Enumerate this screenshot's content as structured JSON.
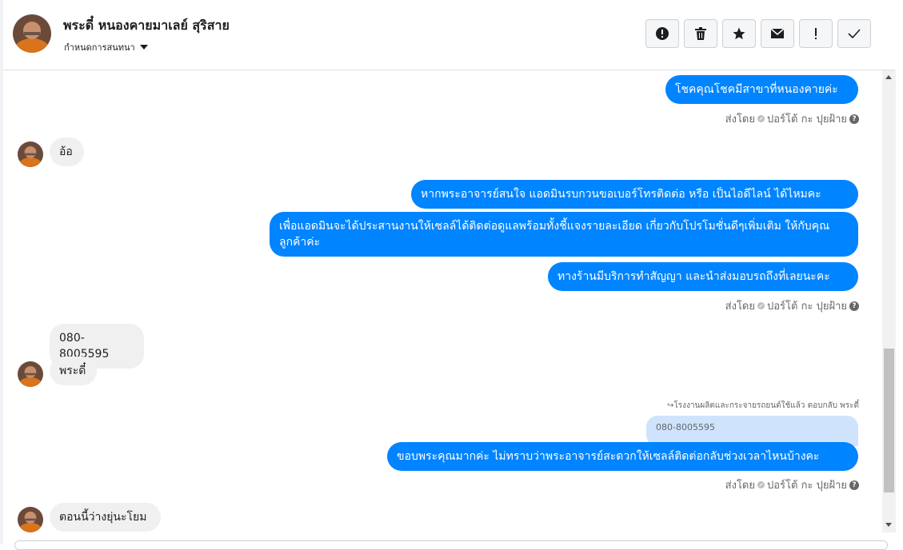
{
  "header": {
    "contact_name": "พระดี๋ หนองคายมาเลย์ สุริสาย",
    "assign_label": "กำหนดการสนทนา",
    "actions": [
      {
        "name": "spam",
        "icon": "alert-circle-icon"
      },
      {
        "name": "delete",
        "icon": "trash-icon"
      },
      {
        "name": "star",
        "icon": "star-icon"
      },
      {
        "name": "mark-unread",
        "icon": "envelope-icon"
      },
      {
        "name": "follow-up",
        "icon": "exclamation-icon"
      },
      {
        "name": "done",
        "icon": "check-icon"
      }
    ]
  },
  "messages": {
    "out_1": "โชคคุณโชคมีสาขาที่หนองคายค่ะ",
    "sent_by_1": "ส่งโดย",
    "agent_1": "ปอร์โต้ กะ ปุยฝ้าย",
    "in_1": "อ้อ",
    "out_2": "หากพระอาจารย์สนใจ แอดมินรบกวนขอเบอร์โทรติดต่อ หรือ เป็นไอดีไลน์ ได้ไหมคะ",
    "out_3": "เพื่อแอดมินจะได้ประสานงานให้เซลล์ได้ติดต่อดูแลพร้อมทั้งชี้แจงรายละเอียด เกี่ยวกับโปรโมชั่นดีๆเพิ่มเติม ให้กับคุณลูกค้าค่ะ",
    "out_4": "ทางร้านมีบริการทำสัญญา และนำส่งมอบรถถึงที่เลยนะคะ",
    "sent_by_2": "ส่งโดย",
    "agent_2": "ปอร์โต้ กะ ปุยฝ้าย",
    "in_2": "080-8005595",
    "in_3": "พระดี๋",
    "reply_note": "โรงงานผลิตและกระจายรถยนต์ใช้แล้ว ตอบกลับ พระดี๋",
    "quoted": "080-8005595",
    "out_5": "ขอบพระคุณมากค่ะ ไม่ทราบว่าพระอาจารย์สะดวกให้เซลล์ติดต่อกลับช่วงเวลาไหนบ้างคะ",
    "sent_by_3": "ส่งโดย",
    "agent_3": "ปอร์โต้ กะ ปุยฝ้าย",
    "in_4": "ตอนนี้ว่างยุ่นะโยม"
  },
  "colors": {
    "outgoing": "#0084ff",
    "incoming": "#f0f0f0",
    "quoted": "#cfe3fd"
  }
}
